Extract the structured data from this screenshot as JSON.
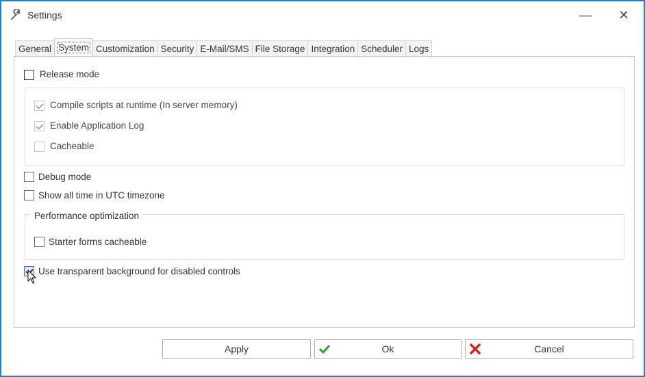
{
  "window": {
    "title": "Settings",
    "minimize": "—",
    "close": "✕"
  },
  "tabs": [
    "General",
    "System",
    "Customization",
    "Security",
    "E-Mail/SMS",
    "File Storage",
    "Integration",
    "Scheduler",
    "Logs"
  ],
  "active_tab": "System",
  "options": {
    "release_mode": {
      "label": "Release mode",
      "checked": false
    },
    "compile_scripts": {
      "label": "Compile scripts at runtime (In server memory)",
      "checked": true,
      "disabled": true
    },
    "enable_log": {
      "label": "Enable Application Log",
      "checked": true,
      "disabled": true
    },
    "cacheable": {
      "label": "Cacheable",
      "checked": false,
      "disabled": true
    },
    "debug_mode": {
      "label": "Debug mode",
      "checked": false
    },
    "utc": {
      "label": "Show all time in UTC timezone",
      "checked": false
    },
    "performance_group": "Performance optimization",
    "starter_forms": {
      "label": "Starter forms cacheable",
      "checked": false
    },
    "transparent_bg": {
      "label": "Use transparent background for disabled controls",
      "checked": true
    }
  },
  "buttons": {
    "apply": "Apply",
    "ok": "Ok",
    "cancel": "Cancel"
  },
  "colors": {
    "border": "#1783c9",
    "ok_icon": "#2a9d3a",
    "cancel_icon": "#d9201f"
  }
}
